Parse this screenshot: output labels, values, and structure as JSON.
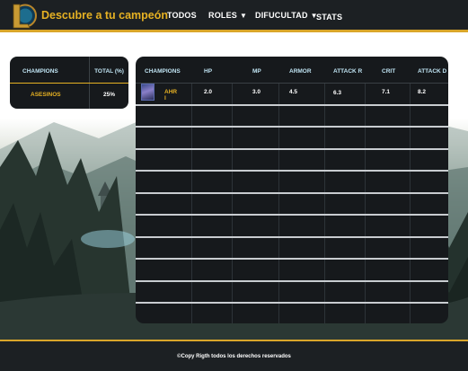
{
  "header": {
    "brand": "Descubre a tu campeón",
    "nav": [
      {
        "label": "TODOS",
        "has_caret": false
      },
      {
        "label": "ROLES",
        "has_caret": true
      },
      {
        "label": "DIFUCULTAD",
        "has_caret": true
      },
      {
        "label": "STATS",
        "has_caret": false
      }
    ],
    "caret": "▼",
    "accent_color": "#e6b123",
    "logo_letter": "L"
  },
  "side_table": {
    "headers": [
      "CHAMPIONS",
      "TOTAL (%)"
    ],
    "rows": [
      {
        "category": "ASESINOS",
        "total": "25%"
      }
    ]
  },
  "main_table": {
    "headers": [
      "CHAMPIONS",
      "HP",
      "MP",
      "ARMOR",
      "ATTACK R",
      "CRIT",
      "ATTACK D"
    ],
    "rows": [
      {
        "name": "AHR I",
        "hp": "2.0",
        "mp": "3.0",
        "armor": "4.5",
        "attack_r": "6.3",
        "crit": "7.1",
        "attack_d": "8.2"
      }
    ],
    "avatar_icon": "champion-portrait"
  },
  "footer": {
    "text": "©Copy Rigth todos los derechos reservados"
  },
  "colors": {
    "nav_bg": "#1c2023",
    "gold": "#d9a62a",
    "table_bg": "#16191c",
    "header_text": "#bfe3f2"
  }
}
